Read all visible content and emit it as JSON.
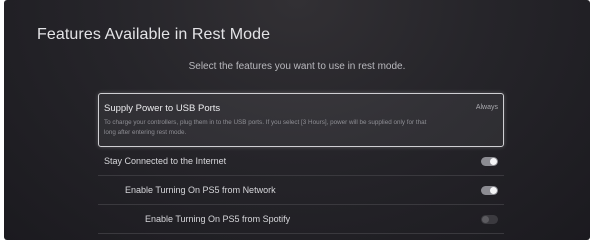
{
  "page": {
    "title": "Features Available in Rest Mode",
    "subtitle": "Select the features you want to use in rest mode."
  },
  "supply_power": {
    "title": "Supply Power to USB Ports",
    "value": "Always",
    "description_line1": "To charge your controllers, plug them in to the USB ports. If you select [3 Hours], power will be supplied only for that",
    "description_line2": "long after entering rest mode."
  },
  "settings": [
    {
      "label": "Stay Connected to the Internet",
      "enabled": true
    },
    {
      "label": "Enable Turning On PS5 from Network",
      "enabled": true
    },
    {
      "label": "Enable Turning On PS5 from Spotify",
      "enabled": false
    }
  ],
  "colors": {
    "background": "#26252a",
    "toggle_on": "#8c8c92",
    "toggle_off": "#3b3a3f",
    "focus_border": "#cfcfd3"
  }
}
